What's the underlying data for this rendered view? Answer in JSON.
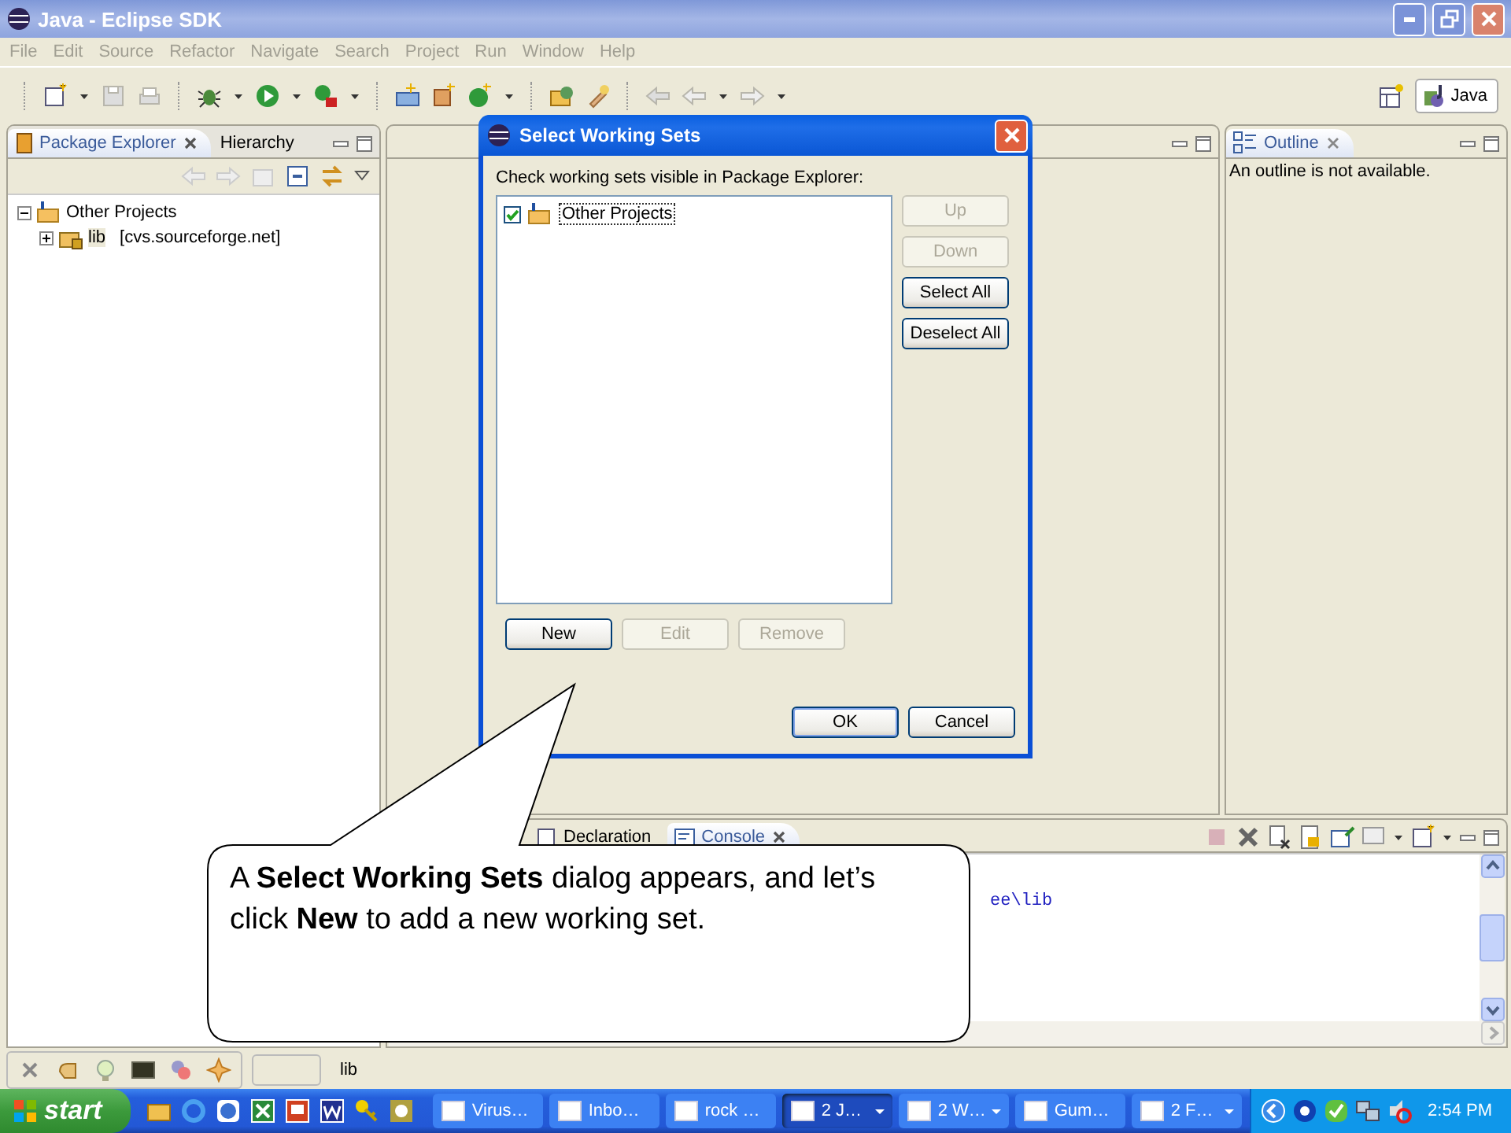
{
  "window": {
    "title": "Java - Eclipse SDK"
  },
  "menu": [
    "File",
    "Edit",
    "Source",
    "Refactor",
    "Navigate",
    "Search",
    "Project",
    "Run",
    "Window",
    "Help"
  ],
  "perspective": {
    "label": "Java",
    "selected": true
  },
  "package_explorer": {
    "tabs": [
      {
        "label": "Package Explorer",
        "selected": true
      },
      {
        "label": "Hierarchy",
        "selected": false
      }
    ],
    "tree": [
      {
        "label": "Other Projects",
        "expanded": true,
        "children": [
          {
            "label": "lib",
            "repo": "[cvs.sourceforge.net]",
            "expanded": false
          }
        ]
      }
    ]
  },
  "outline": {
    "tab": "Outline",
    "message": "An outline is not available."
  },
  "console": {
    "tabs": [
      {
        "label": "Declaration",
        "selected": false
      },
      {
        "label": "Console",
        "selected": true
      }
    ],
    "lines": [
      "ee\\lib"
    ]
  },
  "status_bar": {
    "text": "lib"
  },
  "dialog": {
    "title": "Select Working Sets",
    "instruction": "Check working sets visible in Package Explorer:",
    "items": [
      {
        "label": "Other Projects",
        "checked": true
      }
    ],
    "side_buttons": [
      {
        "label": "Up",
        "disabled": true
      },
      {
        "label": "Down",
        "disabled": true
      },
      {
        "label": "Select All",
        "disabled": false
      },
      {
        "label": "Deselect All",
        "disabled": false
      }
    ],
    "bottom_buttons": [
      {
        "label": "New",
        "disabled": false
      },
      {
        "label": "Edit",
        "disabled": true
      },
      {
        "label": "Remove",
        "disabled": true
      }
    ],
    "footer_buttons": [
      {
        "label": "OK",
        "default": true
      },
      {
        "label": "Cancel",
        "default": false
      }
    ]
  },
  "callout": {
    "text": "A **Select Working Sets** dialog appears, and let’s click **New** to add a new working set."
  },
  "taskbar": {
    "start": "start",
    "tasks": [
      {
        "label": "Virus…",
        "selected": false,
        "grouped": false
      },
      {
        "label": "Inbo…",
        "selected": false,
        "grouped": false
      },
      {
        "label": "rock …",
        "selected": false,
        "grouped": false
      },
      {
        "label": "2 J…",
        "selected": true,
        "grouped": true
      },
      {
        "label": "2 W…",
        "selected": false,
        "grouped": true
      },
      {
        "label": "Gum…",
        "selected": false,
        "grouped": false
      },
      {
        "label": "2 F…",
        "selected": false,
        "grouped": true
      }
    ],
    "clock": "2:54 PM"
  }
}
